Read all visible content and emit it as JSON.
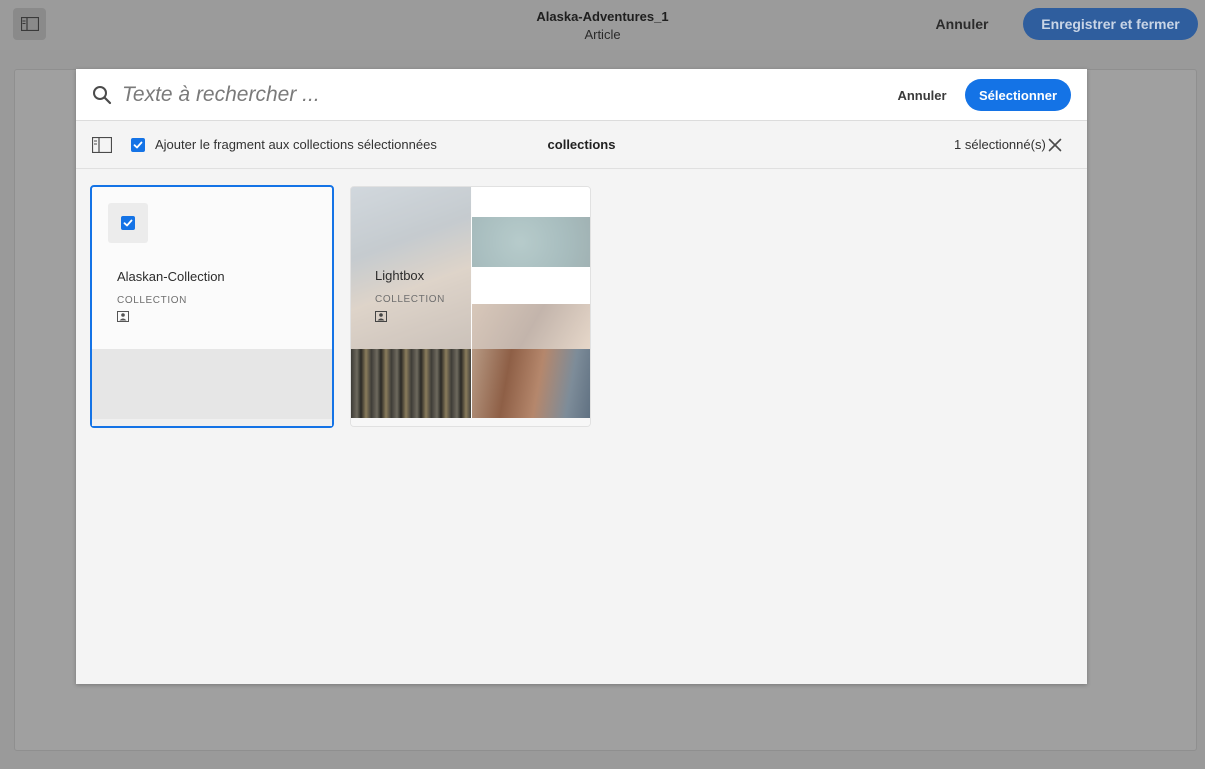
{
  "editor": {
    "title": "Alaska-Adventures_1",
    "subtitle": "Article",
    "cancel_label": "Annuler",
    "save_label": "Enregistrer et fermer"
  },
  "dialog": {
    "search_placeholder": "Texte à rechercher ...",
    "cancel_label": "Annuler",
    "select_label": "Sélectionner",
    "add_fragment_label": "Ajouter le fragment aux collections sélectionnées",
    "add_fragment_checked": true,
    "view_title": "collections",
    "selection_count": "1 sélectionné(s)",
    "cards": [
      {
        "title": "Alaskan-Collection",
        "type": "COLLECTION",
        "selected": true
      },
      {
        "title": "Lightbox",
        "type": "COLLECTION",
        "selected": false
      }
    ]
  },
  "colors": {
    "accent": "#1473e6",
    "save_dimmed": "#2f5e9e"
  },
  "icons": [
    "panel-toggle-icon",
    "search-icon",
    "rail-icon",
    "checkmark-icon",
    "close-icon",
    "collection-icon"
  ]
}
